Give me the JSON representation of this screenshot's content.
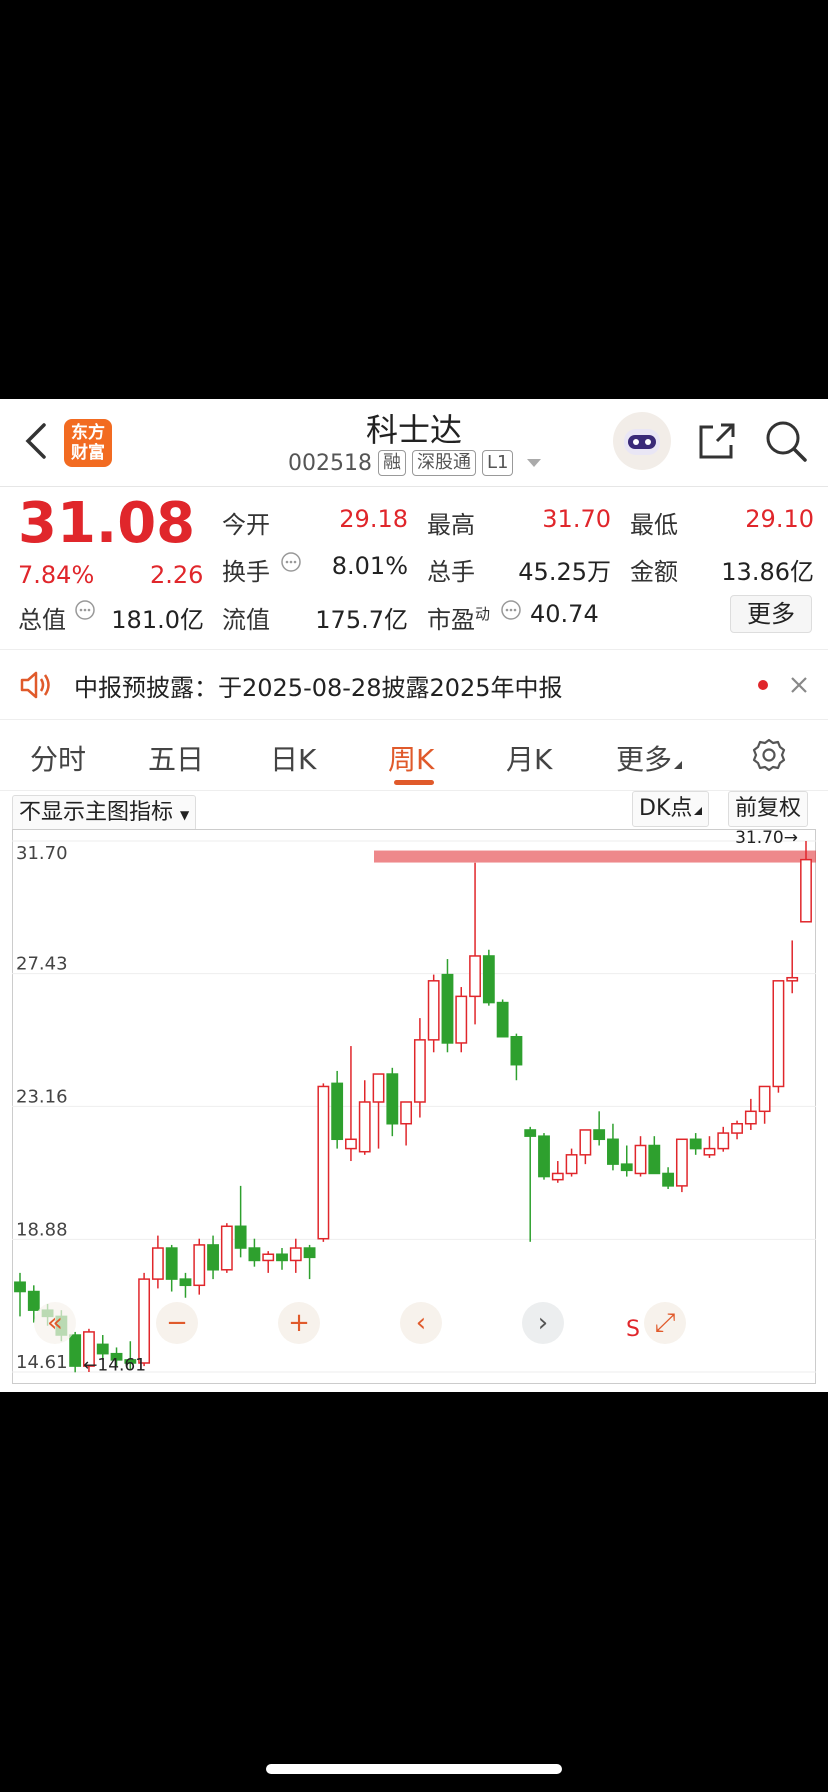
{
  "header": {
    "title": "科士达",
    "code": "002518",
    "tags": [
      "融",
      "深股通",
      "L1"
    ],
    "logo_text": "东方财富"
  },
  "quote": {
    "price": "31.08",
    "change_pct": "7.84%",
    "change_amt": "2.26",
    "fields": [
      {
        "label": "今开",
        "value": "29.18",
        "color": "red"
      },
      {
        "label": "最高",
        "value": "31.70",
        "color": "red"
      },
      {
        "label": "最低",
        "value": "29.10",
        "color": "red"
      },
      {
        "label": "换手",
        "value": "8.01%",
        "color": "dark"
      },
      {
        "label": "总手",
        "value": "45.25万",
        "color": "dark"
      },
      {
        "label": "金额",
        "value": "13.86亿",
        "color": "dark"
      },
      {
        "label": "总值",
        "value": "181.0亿",
        "color": "dark"
      },
      {
        "label": "流值",
        "value": "175.7亿",
        "color": "dark"
      },
      {
        "label": "市盈",
        "value": "40.74",
        "color": "dark"
      }
    ],
    "pe_sup": "动",
    "more_label": "更多"
  },
  "notice": {
    "text": "中报预披露：于2025-08-28披露2025年中报"
  },
  "tabs": [
    "分时",
    "五日",
    "日K",
    "周K",
    "月K",
    "更多"
  ],
  "active_tab": "周K",
  "toolbar": {
    "indicator": "不显示主图指标",
    "dk": "DK点",
    "adjust": "前复权"
  },
  "colors": {
    "up": "#e0262b",
    "down": "#2ea02e",
    "accent": "#e05a2b"
  },
  "chart_data": {
    "type": "candlestick",
    "period": "周K",
    "y_ticks": [
      "31.70",
      "27.43",
      "23.16",
      "18.88",
      "14.61"
    ],
    "ylim": [
      14.61,
      31.7
    ],
    "max_label": "31.70→",
    "min_label": "←14.61",
    "resistance_level": 31.2,
    "candles": [
      [
        17.5,
        17.8,
        16.4,
        17.2
      ],
      [
        17.2,
        17.4,
        16.2,
        16.6
      ],
      [
        16.6,
        16.8,
        16.1,
        16.4
      ],
      [
        16.4,
        16.6,
        15.6,
        15.8
      ],
      [
        15.8,
        15.9,
        14.6,
        14.8
      ],
      [
        14.8,
        16.0,
        14.61,
        15.9
      ],
      [
        15.5,
        15.8,
        15.0,
        15.2
      ],
      [
        15.2,
        15.4,
        14.8,
        15.0
      ],
      [
        15.0,
        15.6,
        14.7,
        14.9
      ],
      [
        14.9,
        17.8,
        14.8,
        17.6
      ],
      [
        17.6,
        19.0,
        17.3,
        18.6
      ],
      [
        18.6,
        18.7,
        17.2,
        17.6
      ],
      [
        17.6,
        17.8,
        17.0,
        17.4
      ],
      [
        17.4,
        18.9,
        17.1,
        18.7
      ],
      [
        18.7,
        19.0,
        17.6,
        17.9
      ],
      [
        17.9,
        19.4,
        17.8,
        19.3
      ],
      [
        19.3,
        20.6,
        18.3,
        18.6
      ],
      [
        18.6,
        18.9,
        18.0,
        18.2
      ],
      [
        18.2,
        18.5,
        17.8,
        18.4
      ],
      [
        18.4,
        18.6,
        17.9,
        18.2
      ],
      [
        18.2,
        18.9,
        17.8,
        18.6
      ],
      [
        18.6,
        18.7,
        17.6,
        18.3
      ],
      [
        18.9,
        23.9,
        18.8,
        23.8
      ],
      [
        23.9,
        24.3,
        21.8,
        22.1
      ],
      [
        21.8,
        25.1,
        21.4,
        22.1
      ],
      [
        21.7,
        24.0,
        21.6,
        23.3
      ],
      [
        23.3,
        24.2,
        21.8,
        24.2
      ],
      [
        24.2,
        24.4,
        22.2,
        22.6
      ],
      [
        22.6,
        23.2,
        21.9,
        23.3
      ],
      [
        23.3,
        26.0,
        22.8,
        25.3
      ],
      [
        25.3,
        27.4,
        24.9,
        27.2
      ],
      [
        27.4,
        27.9,
        24.9,
        25.2
      ],
      [
        25.2,
        27.0,
        24.9,
        26.7
      ],
      [
        26.7,
        31.0,
        25.8,
        28.0
      ],
      [
        28.0,
        28.2,
        26.4,
        26.5
      ],
      [
        26.5,
        26.6,
        25.4,
        25.4
      ],
      [
        25.4,
        25.5,
        24.0,
        24.5
      ],
      [
        22.4,
        22.5,
        18.8,
        22.2
      ],
      [
        22.2,
        22.3,
        20.8,
        20.9
      ],
      [
        20.8,
        21.4,
        20.7,
        21.0
      ],
      [
        21.0,
        21.8,
        20.9,
        21.6
      ],
      [
        21.6,
        22.2,
        21.3,
        22.4
      ],
      [
        22.4,
        23.0,
        21.9,
        22.1
      ],
      [
        22.1,
        22.6,
        21.1,
        21.3
      ],
      [
        21.3,
        21.9,
        20.9,
        21.1
      ],
      [
        21.0,
        22.2,
        20.9,
        21.9
      ],
      [
        21.9,
        22.2,
        21.0,
        21.0
      ],
      [
        21.0,
        21.2,
        20.5,
        20.6
      ],
      [
        20.6,
        22.1,
        20.4,
        22.1
      ],
      [
        22.1,
        22.3,
        21.6,
        21.8
      ],
      [
        21.6,
        22.2,
        21.5,
        21.8
      ],
      [
        21.8,
        22.5,
        21.7,
        22.3
      ],
      [
        22.3,
        22.7,
        22.1,
        22.6
      ],
      [
        22.6,
        23.4,
        22.4,
        23.0
      ],
      [
        23.0,
        23.2,
        22.6,
        23.8
      ],
      [
        23.8,
        24.5,
        23.6,
        27.2
      ],
      [
        27.2,
        28.5,
        26.8,
        27.3
      ],
      [
        29.1,
        31.7,
        29.1,
        31.1
      ]
    ]
  },
  "controls": [
    "«",
    "−",
    "+",
    "‹",
    "›",
    "S",
    "⤢"
  ]
}
